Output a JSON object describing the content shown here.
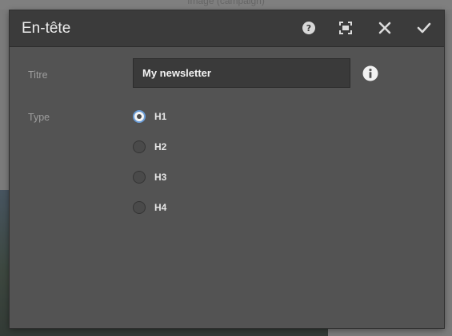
{
  "background": {
    "page_title": "Image (campaign)"
  },
  "dialog": {
    "title": "En-tête",
    "header_icons": [
      "help-icon",
      "fullscreen-icon",
      "close-icon",
      "check-icon"
    ],
    "fields": {
      "title": {
        "label": "Titre",
        "value": "My newsletter",
        "info_icon": "info-icon"
      },
      "type": {
        "label": "Type",
        "options": [
          {
            "label": "H1",
            "checked": true
          },
          {
            "label": "H2",
            "checked": false
          },
          {
            "label": "H3",
            "checked": false
          },
          {
            "label": "H4",
            "checked": false
          }
        ]
      }
    }
  },
  "colors": {
    "accent": "#6a9cd6",
    "dialog_bg": "#535353",
    "header_bg": "#3b3b3b"
  }
}
